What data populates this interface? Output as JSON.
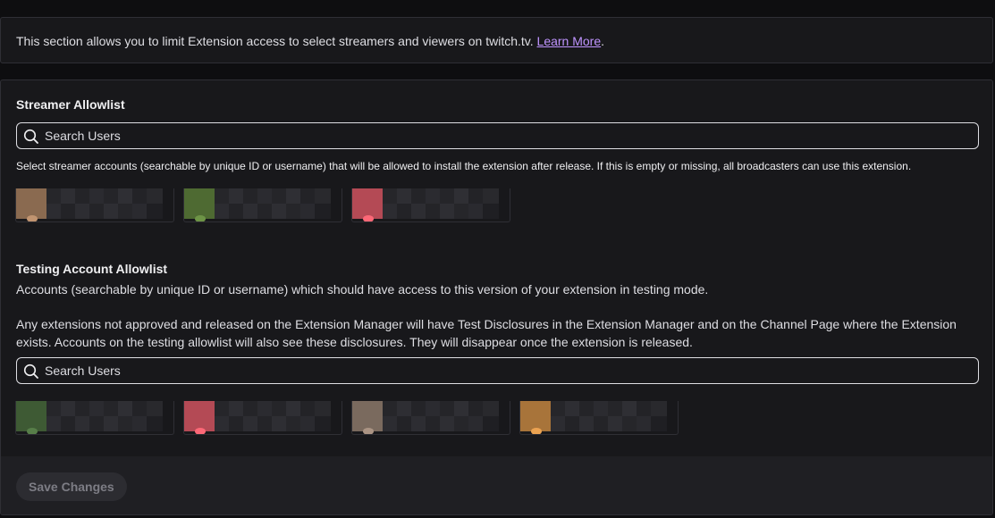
{
  "info": {
    "text": "This section allows you to limit Extension access to select streamers and viewers on twitch.tv. ",
    "link_label": "Learn More",
    "suffix": "."
  },
  "streamer_allowlist": {
    "title": "Streamer Allowlist",
    "search_placeholder": "Search Users",
    "note": "Select streamer accounts (searchable by unique ID or username) that will be allowed to install the extension after release. If this is empty or missing, all broadcasters can use this extension.",
    "users": [
      {
        "avatar_color": "#8a6a50"
      },
      {
        "avatar_color": "#4e6a32"
      },
      {
        "avatar_color": "#b44a55"
      }
    ]
  },
  "testing_allowlist": {
    "title": "Testing Account Allowlist",
    "description": "Accounts (searchable by unique ID or username) which should have access to this version of your extension in testing mode.",
    "disclosure": "Any extensions not approved and released on the Extension Manager will have Test Disclosures in the Extension Manager and on the Channel Page where the Extension exists. Accounts on the testing allowlist will also see these disclosures. They will disappear once the extension is released.",
    "search_placeholder": "Search Users",
    "users": [
      {
        "avatar_color": "#3e5a34"
      },
      {
        "avatar_color": "#b44a55"
      },
      {
        "avatar_color": "#7a6a5e"
      },
      {
        "avatar_color": "#a8743a"
      }
    ]
  },
  "footer": {
    "save_label": "Save Changes"
  }
}
